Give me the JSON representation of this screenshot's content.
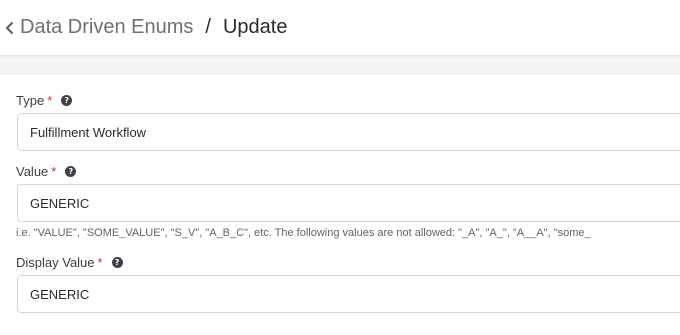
{
  "header": {
    "back_icon": "chevron-left-icon",
    "parent_title": "Data Driven Enums",
    "separator": "/",
    "current_title": "Update"
  },
  "form": {
    "type": {
      "label": "Type",
      "required_mark": "*",
      "help_icon": "question-circle-icon",
      "value": "Fulfillment Workflow"
    },
    "value": {
      "label": "Value",
      "required_mark": "*",
      "help_icon": "question-circle-icon",
      "value": "GENERIC",
      "hint": "i.e. \"VALUE\", \"SOME_VALUE\", \"S_V\", \"A_B_C\", etc. The following values are not allowed: \"_A\", \"A_\", \"A__A\", \"some_"
    },
    "display_value": {
      "label": "Display Value",
      "required_mark": "*",
      "help_icon": "question-circle-icon",
      "value": "GENERIC"
    }
  },
  "colors": {
    "required": "#d0312d",
    "header_bg": "#ffffff",
    "page_bg": "#f4f5f7"
  }
}
